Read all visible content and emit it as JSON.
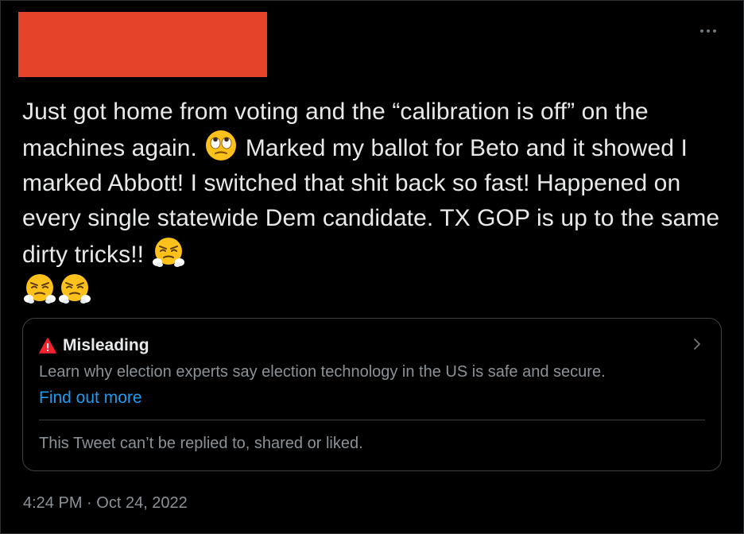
{
  "tweet": {
    "text_parts": {
      "p1": "Just got home from voting and the “calibration is off” on the machines again. ",
      "p2": " Marked my ballot for Beto and it showed I marked Abbott! I switched that shit back so fast! Happened on every single statewide Dem candidate. TX GOP is up to the same dirty tricks!! "
    },
    "emojis": [
      "face-with-rolling-eyes",
      "face-with-steam-from-nose",
      "face-with-steam-from-nose",
      "face-with-steam-from-nose"
    ],
    "time": "4:24 PM",
    "separator": "·",
    "date": "Oct 24, 2022"
  },
  "notice": {
    "title": "Misleading",
    "description": "Learn why election experts say election technology in the US is safe and secure.",
    "link": "Find out more",
    "footer": "This Tweet can’t be replied to, shared or liked.",
    "icon": "warning-icon",
    "colors": {
      "warning": "#f4212e",
      "link": "#1d9bf0"
    }
  },
  "colors": {
    "background": "#000000",
    "text": "#e7e9ea",
    "secondary_text": "#8b9298",
    "redaction": "#e5442b"
  }
}
